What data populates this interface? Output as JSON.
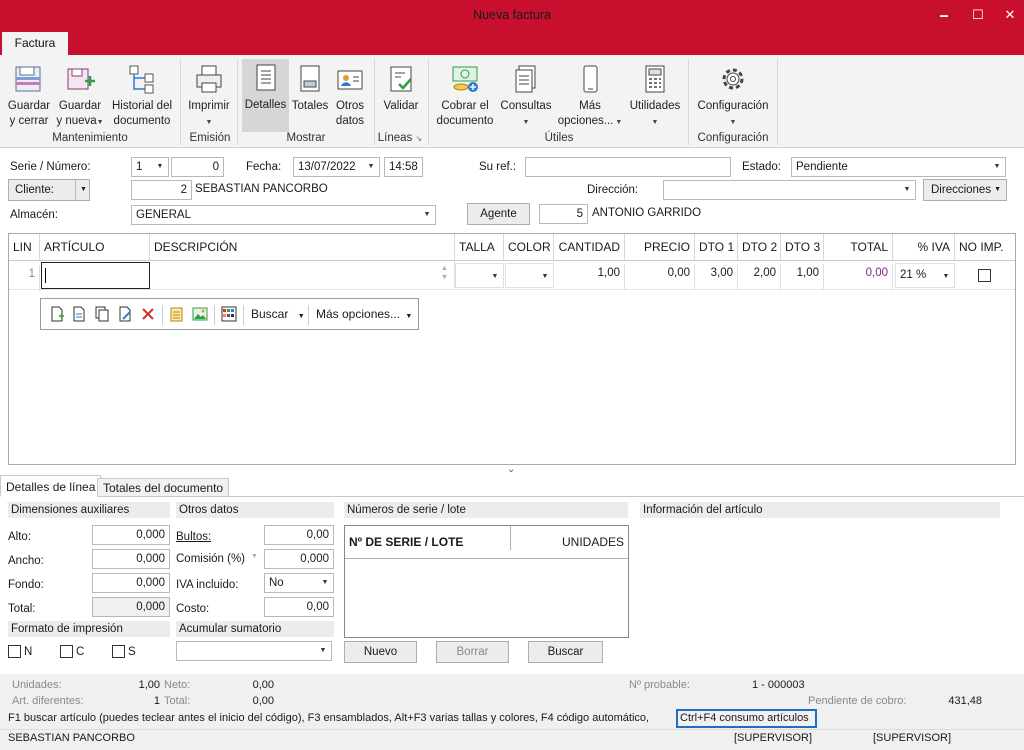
{
  "window": {
    "title": "Nueva factura",
    "minimize": "🗕",
    "maximize": "☐",
    "close": "✕"
  },
  "ribbon": {
    "tab": "Factura",
    "buttons": {
      "guardar_cerrar": "Guardar\ny cerrar",
      "guardar_nueva": "Guardar\ny nueva",
      "historial": "Historial del\ndocumento",
      "imprimir": "Imprimir",
      "detalles": "Detalles",
      "totales": "Totales",
      "otros_datos": "Otros\ndatos",
      "validar": "Validar",
      "cobrar": "Cobrar el\ndocumento",
      "consultas": "Consultas",
      "mas_opciones": "Más\nopciones...",
      "utilidades": "Utilidades",
      "configuracion": "Configuración"
    },
    "groups": {
      "mantenimiento": "Mantenimiento",
      "emision": "Emisión",
      "mostrar": "Mostrar",
      "lineas": "Líneas",
      "utiles": "Útiles",
      "configuracion": "Configuración"
    }
  },
  "header": {
    "serie_label": "Serie / Número:",
    "serie_value": "1",
    "numero_value": "0",
    "fecha_label": "Fecha:",
    "fecha_value": "13/07/2022",
    "hora_value": "14:58",
    "suref_label": "Su ref.:",
    "suref_value": "",
    "estado_label": "Estado:",
    "estado_value": "Pendiente",
    "cliente_label": "Cliente:",
    "cliente_code": "2",
    "cliente_name": "SEBASTIAN PANCORBO",
    "direccion_label": "Dirección:",
    "direccion_value": "",
    "direcciones_button": "Direcciones",
    "almacen_label": "Almacén:",
    "almacen_value": "GENERAL",
    "agente_button": "Agente",
    "agente_code": "5",
    "agente_name": "ANTONIO GARRIDO"
  },
  "grid": {
    "columns": [
      "LIN",
      "ARTÍCULO",
      "DESCRIPCIÓN",
      "TALLA",
      "COLOR",
      "CANTIDAD",
      "PRECIO",
      "DTO 1",
      "DTO 2",
      "DTO 3",
      "TOTAL",
      "% IVA",
      "NO IMP."
    ],
    "row": {
      "lin": "1",
      "articulo": "",
      "descripcion": "",
      "talla": "",
      "color": "",
      "cantidad": "1,00",
      "precio": "0,00",
      "dto1": "3,00",
      "dto2": "2,00",
      "dto3": "1,00",
      "total": "0,00",
      "iva": "21 %",
      "no_imp": false
    },
    "toolbar": {
      "buscar": "Buscar",
      "mas_opciones": "Más opciones..."
    }
  },
  "bottom_tabs": [
    "Detalles de línea",
    "Totales del documento"
  ],
  "detalles": {
    "dimensiones_title": "Dimensiones auxiliares",
    "alto_label": "Alto:",
    "alto": "0,000",
    "ancho_label": "Ancho:",
    "ancho": "0,000",
    "fondo_label": "Fondo:",
    "fondo": "0,000",
    "total_label": "Total:",
    "total": "0,000",
    "otros_title": "Otros datos",
    "bultos_label": "Bultos:",
    "bultos": "0,00",
    "comision_label": "Comisión (%)",
    "comision": "0,000",
    "iva_incluido_label": "IVA incluido:",
    "iva_incluido": "No",
    "costo_label": "Costo:",
    "costo": "0,00",
    "formato_title": "Formato de impresión",
    "formato_n": "N",
    "formato_c": "C",
    "formato_s": "S",
    "acumular_title": "Acumular sumatorio",
    "acumular_value": "",
    "series_title": "Números de serie / lote",
    "series_col1": "Nº DE SERIE / LOTE",
    "series_col2": "UNIDADES",
    "nuevo": "Nuevo",
    "borrar": "Borrar",
    "buscar": "Buscar",
    "info_title": "Información del artículo"
  },
  "footer": {
    "unidades_label": "Unidades:",
    "unidades": "1,00",
    "art_dif_label": "Art. diferentes:",
    "art_dif": "1",
    "neto_label": "Neto:",
    "neto": "0,00",
    "total_label": "Total:",
    "total": "0,00",
    "nprob_label": "Nº probable:",
    "nprob": "1 - 000003",
    "pendiente_label": "Pendiente de cobro:",
    "pendiente": "431,48",
    "hint": "F1 buscar artículo (puedes teclear antes el inicio del código), F3 ensamblados, Alt+F3 varias tallas y colores, F4 código automático,",
    "hint_box": "Ctrl+F4 consumo artículos",
    "status_client": "SEBASTIAN PANCORBO",
    "status_user1": "[SUPERVISOR]",
    "status_user2": "[SUPERVISOR]"
  },
  "colors": {
    "accent": "#c8102e",
    "total_text": "#7a2a7a"
  }
}
